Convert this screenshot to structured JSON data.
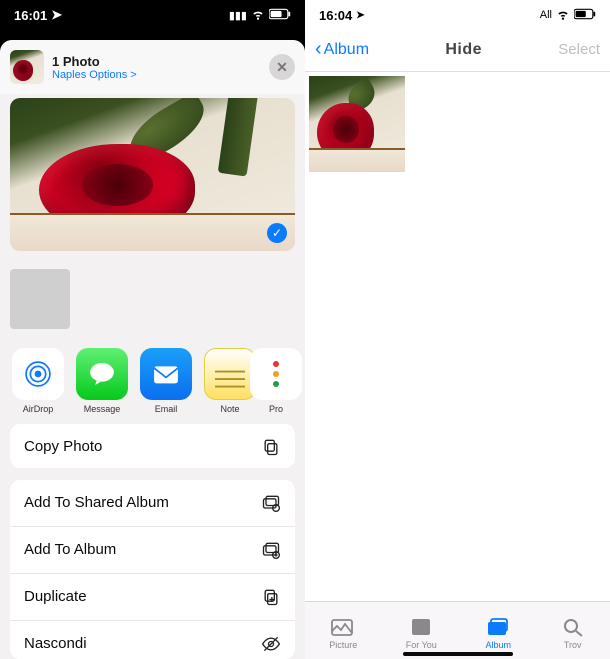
{
  "left": {
    "status": {
      "time": "16:01",
      "icons": "◂ ıl ᯤ ▢"
    },
    "header": {
      "title": "1 Photo",
      "subtitle": "Naples Options >"
    },
    "apps": [
      {
        "key": "airdrop",
        "label": "AirDrop"
      },
      {
        "key": "message",
        "label": "Message"
      },
      {
        "key": "email",
        "label": "Email"
      },
      {
        "key": "note",
        "label": "Note"
      },
      {
        "key": "more",
        "label": "Pro"
      }
    ],
    "copy_action": "Copy Photo",
    "actions": [
      "Add To Shared Album",
      "Add To Album",
      "Duplicate",
      "Nascondi"
    ]
  },
  "right": {
    "status": {
      "time": "16:04",
      "right_text": "All",
      "icons": "ᯤ ▢"
    },
    "nav": {
      "back": "Album",
      "title": "Hide",
      "select": "Select"
    },
    "tabs": [
      {
        "key": "picture",
        "label": "Picture"
      },
      {
        "key": "foryou",
        "label": "For You"
      },
      {
        "key": "album",
        "label": "Album"
      },
      {
        "key": "search",
        "label": "Trov"
      }
    ],
    "active_tab": "album"
  }
}
